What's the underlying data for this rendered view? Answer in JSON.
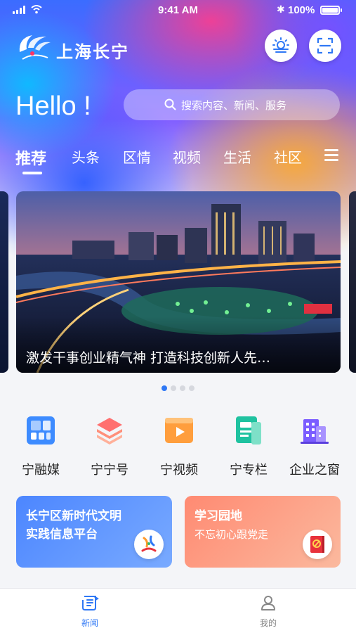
{
  "status_bar": {
    "time": "9:41 AM",
    "battery": "100%"
  },
  "header": {
    "app_title": "上海长宁",
    "greeting": "Hello !"
  },
  "search": {
    "placeholder": "搜索内容、新闻、服务"
  },
  "tabs": [
    {
      "label": "推荐",
      "active": true
    },
    {
      "label": "头条"
    },
    {
      "label": "区情"
    },
    {
      "label": "视频"
    },
    {
      "label": "生活"
    },
    {
      "label": "社区"
    }
  ],
  "banner": {
    "caption": "激发干事创业精气神 打造科技创新人先…",
    "page_count": 4,
    "current_page": 1
  },
  "services": [
    {
      "label": "宁融媒",
      "icon": "media-grid-icon"
    },
    {
      "label": "宁宁号",
      "icon": "layers-icon"
    },
    {
      "label": "宁视频",
      "icon": "video-play-icon"
    },
    {
      "label": "宁专栏",
      "icon": "column-doc-icon"
    },
    {
      "label": "企业之窗",
      "icon": "building-icon"
    }
  ],
  "cards": [
    {
      "title_line1": "长宁区新时代文明",
      "title_line2": "实践信息平台",
      "subtitle": ""
    },
    {
      "title_line1": "学习园地",
      "title_line2": "",
      "subtitle": "不忘初心跟党走"
    }
  ],
  "bottom_nav": [
    {
      "label": "新闻",
      "active": true
    },
    {
      "label": "我的"
    }
  ],
  "colors": {
    "accent": "#2f78f5",
    "card_blue": "#4c86ff",
    "card_red": "#ff8a72"
  }
}
